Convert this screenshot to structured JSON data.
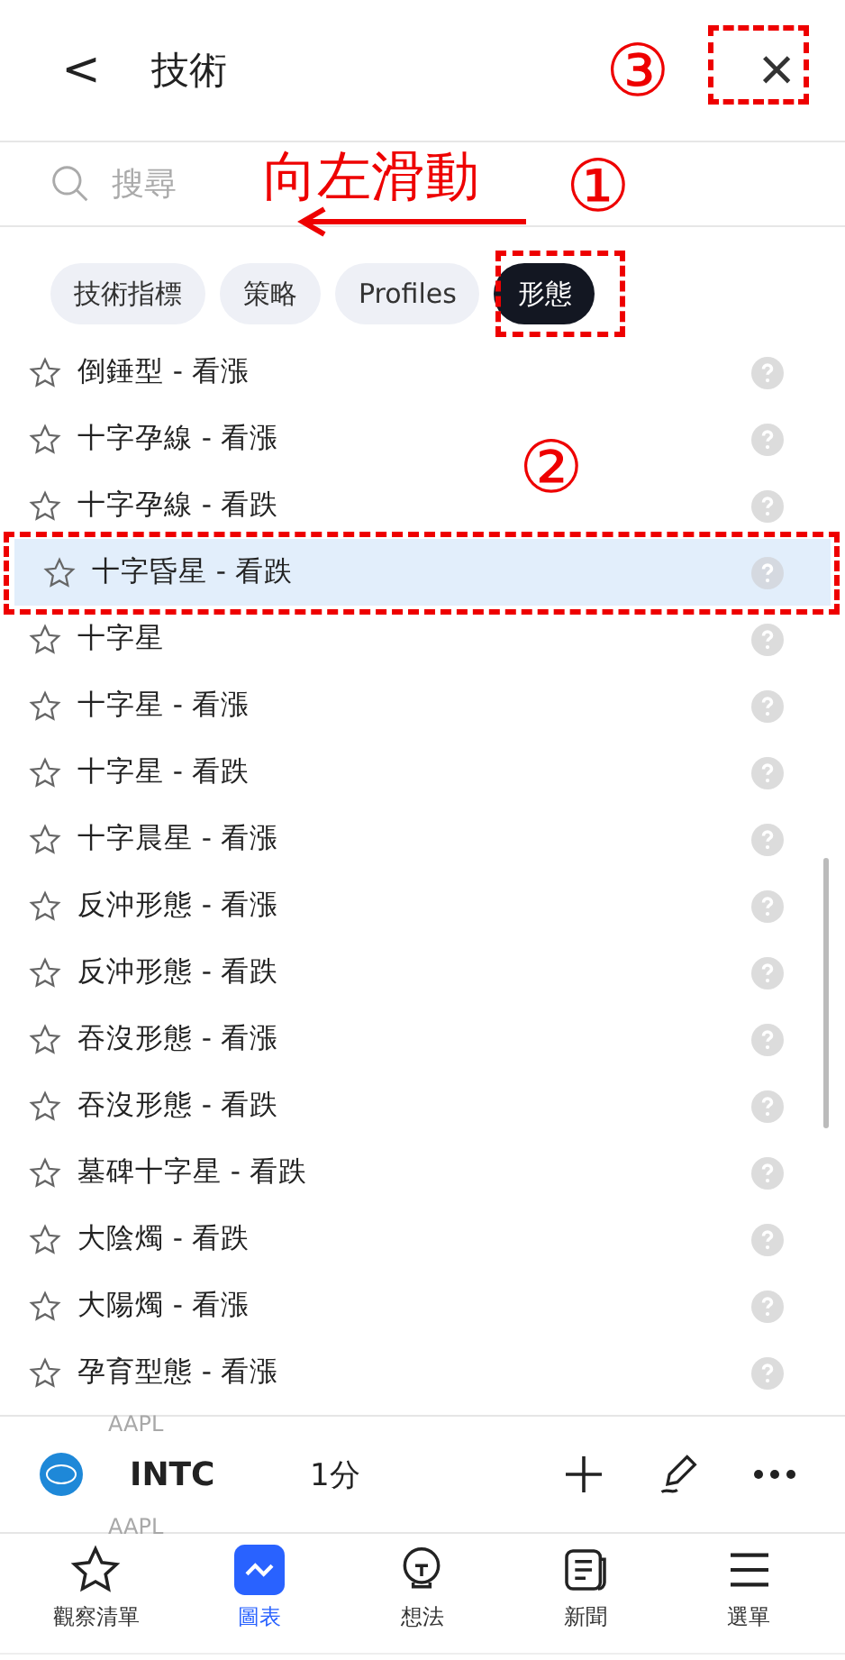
{
  "header": {
    "back": "<",
    "title": "技術",
    "close": "×"
  },
  "search": {
    "placeholder": "搜尋"
  },
  "tabs": [
    {
      "label": "技術指標",
      "selected": false
    },
    {
      "label": "策略",
      "selected": false
    },
    {
      "label": "Profiles",
      "selected": false
    },
    {
      "label": "形態",
      "selected": true
    }
  ],
  "patterns": [
    {
      "name": "倒錘型 - 看漲",
      "favorite": false,
      "selected": false
    },
    {
      "name": "十字孕線 - 看漲",
      "favorite": false,
      "selected": false
    },
    {
      "name": "十字孕線 - 看跌",
      "favorite": false,
      "selected": false
    },
    {
      "name": "十字昏星 - 看跌",
      "favorite": false,
      "selected": true
    },
    {
      "name": "十字星",
      "favorite": false,
      "selected": false
    },
    {
      "name": "十字星 - 看漲",
      "favorite": false,
      "selected": false
    },
    {
      "name": "十字星 - 看跌",
      "favorite": false,
      "selected": false
    },
    {
      "name": "十字晨星 - 看漲",
      "favorite": false,
      "selected": false
    },
    {
      "name": "反沖形態 - 看漲",
      "favorite": false,
      "selected": false
    },
    {
      "name": "反沖形態 - 看跌",
      "favorite": false,
      "selected": false
    },
    {
      "name": "吞沒形態 - 看漲",
      "favorite": false,
      "selected": false
    },
    {
      "name": "吞沒形態 - 看跌",
      "favorite": false,
      "selected": false
    },
    {
      "name": "墓碑十字星 - 看跌",
      "favorite": false,
      "selected": false
    },
    {
      "name": "大陰燭 - 看跌",
      "favorite": false,
      "selected": false
    },
    {
      "name": "大陽燭 - 看漲",
      "favorite": false,
      "selected": false
    },
    {
      "name": "孕育型態 - 看漲",
      "favorite": false,
      "selected": false
    }
  ],
  "symbol_bar": {
    "previous": "AAPL",
    "symbol": "INTC",
    "interval": "1分",
    "next": "AAPL"
  },
  "nav": [
    {
      "label": "觀察清單",
      "selected": false
    },
    {
      "label": "圖表",
      "selected": true
    },
    {
      "label": "想法",
      "selected": false
    },
    {
      "label": "新聞",
      "selected": false
    },
    {
      "label": "選單",
      "selected": false
    }
  ],
  "annotations": {
    "swipe_text": "向左滑動",
    "step_1": "①",
    "step_2": "②",
    "step_3": "③"
  }
}
